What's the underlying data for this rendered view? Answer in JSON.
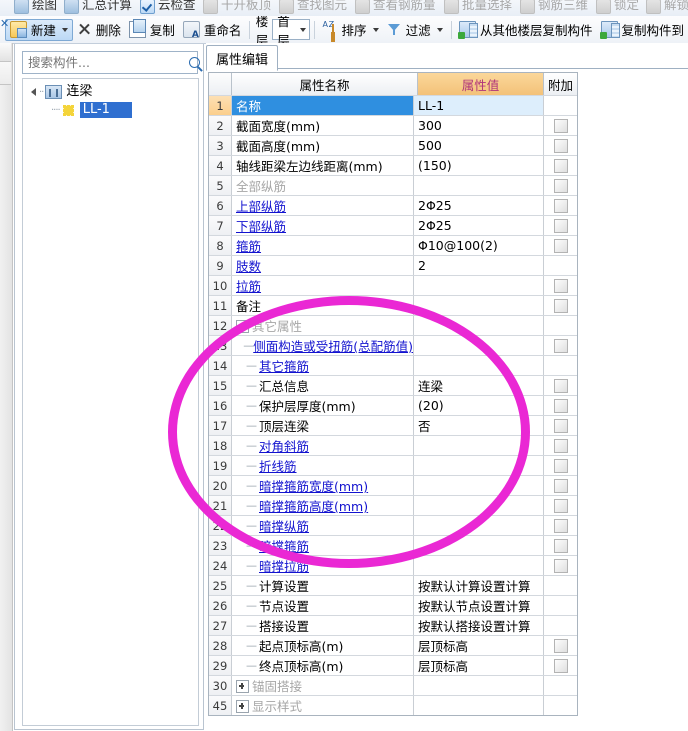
{
  "menu_strip": {
    "items": [
      {
        "label": "绘图",
        "icon": "pencil-icon",
        "dim": false
      },
      {
        "label": "汇总计算",
        "icon": "sigma-icon",
        "dim": false
      },
      {
        "label": "云检查",
        "icon": "cloud-check-icon",
        "dim": false
      },
      {
        "label": "干开板顶",
        "icon": "plate-icon",
        "dim": true
      },
      {
        "label": "查找图元",
        "icon": "find-element-icon",
        "dim": true
      },
      {
        "label": "查看钢筋量",
        "icon": "view-rebar-icon",
        "dim": true
      },
      {
        "label": "批量选择",
        "icon": "batch-select-icon",
        "dim": true
      },
      {
        "label": "钢筋三维",
        "icon": "rebar-3d-icon",
        "dim": true
      },
      {
        "label": "锁定",
        "icon": "lock-icon",
        "dim": true
      },
      {
        "label": "解锁",
        "icon": "unlock-icon",
        "dim": true
      }
    ]
  },
  "toolbar": {
    "new_label": "新建",
    "delete_label": "删除",
    "copy_label": "复制",
    "rename_label": "重命名",
    "floor_label": "楼层",
    "floor_value": "首层",
    "sort_label": "排序",
    "filter_label": "过滤",
    "copy_from_other_floor_label": "从其他楼层复制构件",
    "copy_to_label": "复制构件到"
  },
  "sidebar": {
    "search_placeholder": "搜索构件...",
    "tree": [
      {
        "label": "连梁",
        "level": 1,
        "icon": "beam-icon",
        "selected": false,
        "expanded": true
      },
      {
        "label": "LL-1",
        "level": 2,
        "icon": "gear-icon",
        "selected": true
      }
    ]
  },
  "right_pane": {
    "tab_label": "属性编辑",
    "columns": {
      "index": "",
      "name": "属性名称",
      "value": "属性值",
      "attach": "附加"
    },
    "rows": [
      {
        "idx": "1",
        "name": "名称",
        "value": "LL-1",
        "style": "selected",
        "indent": 0,
        "checkbox": false
      },
      {
        "idx": "2",
        "name": "截面宽度(mm)",
        "value": "300",
        "style": "normal",
        "indent": 0,
        "checkbox": true
      },
      {
        "idx": "3",
        "name": "截面高度(mm)",
        "value": "500",
        "style": "normal",
        "indent": 0,
        "checkbox": true
      },
      {
        "idx": "4",
        "name": "轴线距梁左边线距离(mm)",
        "value": "(150)",
        "style": "normal",
        "indent": 0,
        "checkbox": true
      },
      {
        "idx": "5",
        "name": "全部纵筋",
        "value": "",
        "style": "grey",
        "indent": 0,
        "checkbox": true
      },
      {
        "idx": "6",
        "name": "上部纵筋",
        "value": "2Φ25",
        "style": "link",
        "indent": 0,
        "checkbox": true
      },
      {
        "idx": "7",
        "name": "下部纵筋",
        "value": "2Φ25",
        "style": "link",
        "indent": 0,
        "checkbox": true
      },
      {
        "idx": "8",
        "name": "箍筋",
        "value": "Φ10@100(2)",
        "style": "link",
        "indent": 0,
        "checkbox": true
      },
      {
        "idx": "9",
        "name": "肢数",
        "value": "2",
        "style": "link",
        "indent": 0,
        "checkbox": false
      },
      {
        "idx": "10",
        "name": "拉筋",
        "value": "",
        "style": "link",
        "indent": 0,
        "checkbox": true
      },
      {
        "idx": "11",
        "name": "备注",
        "value": "",
        "style": "normal",
        "indent": 0,
        "checkbox": true
      },
      {
        "idx": "12",
        "name": "其它属性",
        "value": "",
        "style": "group",
        "indent": 0,
        "checkbox": false,
        "expander": "minus"
      },
      {
        "idx": "13",
        "name": "侧面构造或受扭筋(总配筋值)",
        "value": "",
        "style": "link",
        "indent": 1,
        "checkbox": true
      },
      {
        "idx": "14",
        "name": "其它箍筋",
        "value": "",
        "style": "link",
        "indent": 1,
        "checkbox": false
      },
      {
        "idx": "15",
        "name": "汇总信息",
        "value": "连梁",
        "style": "normal",
        "indent": 1,
        "checkbox": true
      },
      {
        "idx": "16",
        "name": "保护层厚度(mm)",
        "value": "(20)",
        "style": "normal",
        "indent": 1,
        "checkbox": true
      },
      {
        "idx": "17",
        "name": "顶层连梁",
        "value": "否",
        "style": "normal",
        "indent": 1,
        "checkbox": true
      },
      {
        "idx": "18",
        "name": "对角斜筋",
        "value": "",
        "style": "link",
        "indent": 1,
        "checkbox": true
      },
      {
        "idx": "19",
        "name": "折线筋",
        "value": "",
        "style": "link",
        "indent": 1,
        "checkbox": true
      },
      {
        "idx": "20",
        "name": "暗撑箍筋宽度(mm)",
        "value": "",
        "style": "link",
        "indent": 1,
        "checkbox": true
      },
      {
        "idx": "21",
        "name": "暗撑箍筋高度(mm)",
        "value": "",
        "style": "link",
        "indent": 1,
        "checkbox": true
      },
      {
        "idx": "22",
        "name": "暗撑纵筋",
        "value": "",
        "style": "link",
        "indent": 1,
        "checkbox": true
      },
      {
        "idx": "23",
        "name": "暗撑箍筋",
        "value": "",
        "style": "link",
        "indent": 1,
        "checkbox": true
      },
      {
        "idx": "24",
        "name": "暗撑拉筋",
        "value": "",
        "style": "link",
        "indent": 1,
        "checkbox": true
      },
      {
        "idx": "25",
        "name": "计算设置",
        "value": "按默认计算设置计算",
        "style": "normal",
        "indent": 1,
        "checkbox": false
      },
      {
        "idx": "26",
        "name": "节点设置",
        "value": "按默认节点设置计算",
        "style": "normal",
        "indent": 1,
        "checkbox": false
      },
      {
        "idx": "27",
        "name": "搭接设置",
        "value": "按默认搭接设置计算",
        "style": "normal",
        "indent": 1,
        "checkbox": false
      },
      {
        "idx": "28",
        "name": "起点顶标高(m)",
        "value": "层顶标高",
        "style": "normal",
        "indent": 1,
        "checkbox": true
      },
      {
        "idx": "29",
        "name": "终点顶标高(m)",
        "value": "层顶标高",
        "style": "normal",
        "indent": 1,
        "checkbox": true
      },
      {
        "idx": "30",
        "name": "锚固搭接",
        "value": "",
        "style": "group",
        "indent": 0,
        "checkbox": false,
        "expander": "plus"
      },
      {
        "idx": "45",
        "name": "显示样式",
        "value": "",
        "style": "group",
        "indent": 0,
        "checkbox": false,
        "expander": "plus"
      }
    ]
  },
  "annotation": {
    "shape": "ellipse",
    "color": "#ea28d4"
  }
}
